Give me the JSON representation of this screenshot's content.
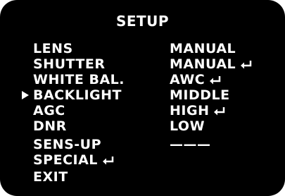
{
  "osd": {
    "title": "SETUP",
    "items": [
      {
        "label": "LENS",
        "value": "MANUAL"
      },
      {
        "label": "SHUTTER",
        "value": "MANUAL"
      },
      {
        "label": "WHITE BAL.",
        "value": "AWC"
      },
      {
        "label": "BACKLIGHT",
        "value": "MIDDLE"
      },
      {
        "label": "AGC",
        "value": "HIGH"
      },
      {
        "label": "DNR",
        "value": "LOW"
      },
      {
        "label": "SENS-UP",
        "value": "———"
      },
      {
        "label": "SPECIAL",
        "value": ""
      },
      {
        "label": "EXIT",
        "value": ""
      }
    ],
    "selected_item": "BACKLIGHT",
    "cursor_icon": "triangle-right-icon",
    "submenu_icon": "enter-arrow-icon",
    "colors": {
      "background": "#000000",
      "text": "#ffffff"
    }
  }
}
